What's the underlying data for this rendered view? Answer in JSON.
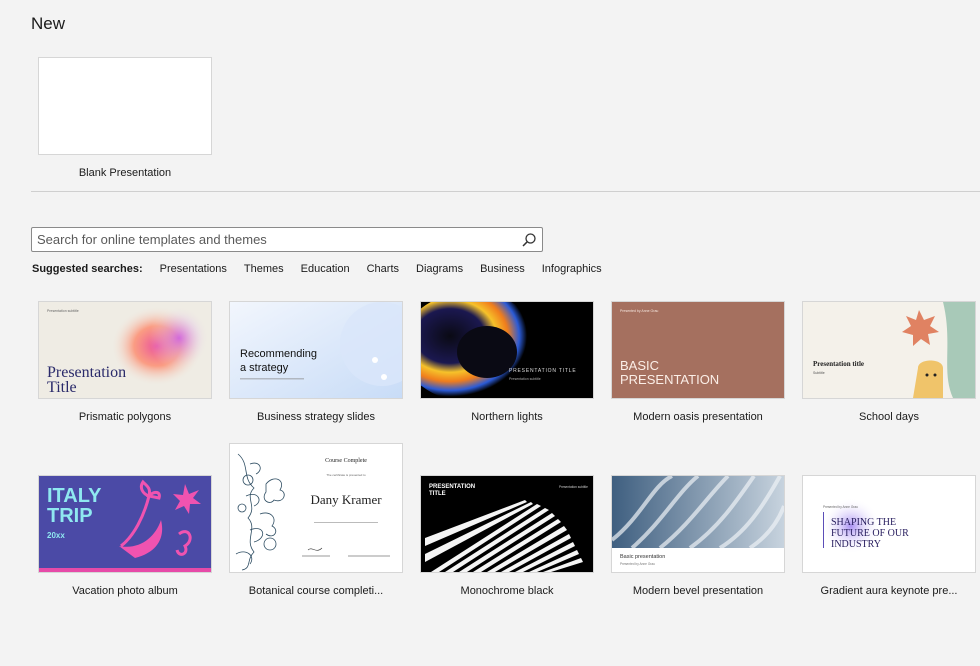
{
  "heading": "New",
  "blank": {
    "label": "Blank Presentation"
  },
  "search": {
    "placeholder": "Search for online templates and themes"
  },
  "suggested": {
    "label": "Suggested searches:",
    "terms": [
      "Presentations",
      "Themes",
      "Education",
      "Charts",
      "Diagrams",
      "Business",
      "Infographics"
    ]
  },
  "templates": [
    {
      "name": "Prismatic polygons",
      "t1": "Presentation",
      "t2": "Title",
      "sub": "Presentation subtitle"
    },
    {
      "name": "Business strategy slides",
      "t1": "Recommending",
      "t2": "a strategy",
      "sub": ""
    },
    {
      "name": "Northern lights",
      "t1": "PRESENTATION TITLE",
      "sub": "Presentation subtitle"
    },
    {
      "name": "Modern oasis presentation",
      "t1": "BASIC",
      "t2": "PRESENTATION",
      "sub": "Presented by Anne Grau"
    },
    {
      "name": "School days",
      "t1": "Presentation title",
      "sub": "Subtitle"
    },
    {
      "name": "Vacation photo album",
      "t1": "ITALY",
      "t2": "TRIP",
      "sub": "20xx"
    },
    {
      "name": "Botanical course completi...",
      "t1": "Course Complete",
      "t2": "Dany Kramer",
      "sub": "The certificate is presented to"
    },
    {
      "name": "Monochrome black",
      "t1": "PRESENTATION",
      "t2": "TITLE",
      "sub": "Presentation subtitle"
    },
    {
      "name": "Modern bevel presentation",
      "t1": "Basic presentation",
      "sub": "Presented by Anne Grau"
    },
    {
      "name": "Gradient aura keynote pre...",
      "t1": "SHAPING THE",
      "t2": "FUTURE OF OUR",
      "t3": "INDUSTRY",
      "sub": "Presented by Anne Grau"
    }
  ],
  "colors": {
    "background": "#f3f3f3",
    "oasis": "#a5705f",
    "italy": "#4b4aa6",
    "italyText": "#8fe8f0",
    "aura": "#a58bf2"
  }
}
